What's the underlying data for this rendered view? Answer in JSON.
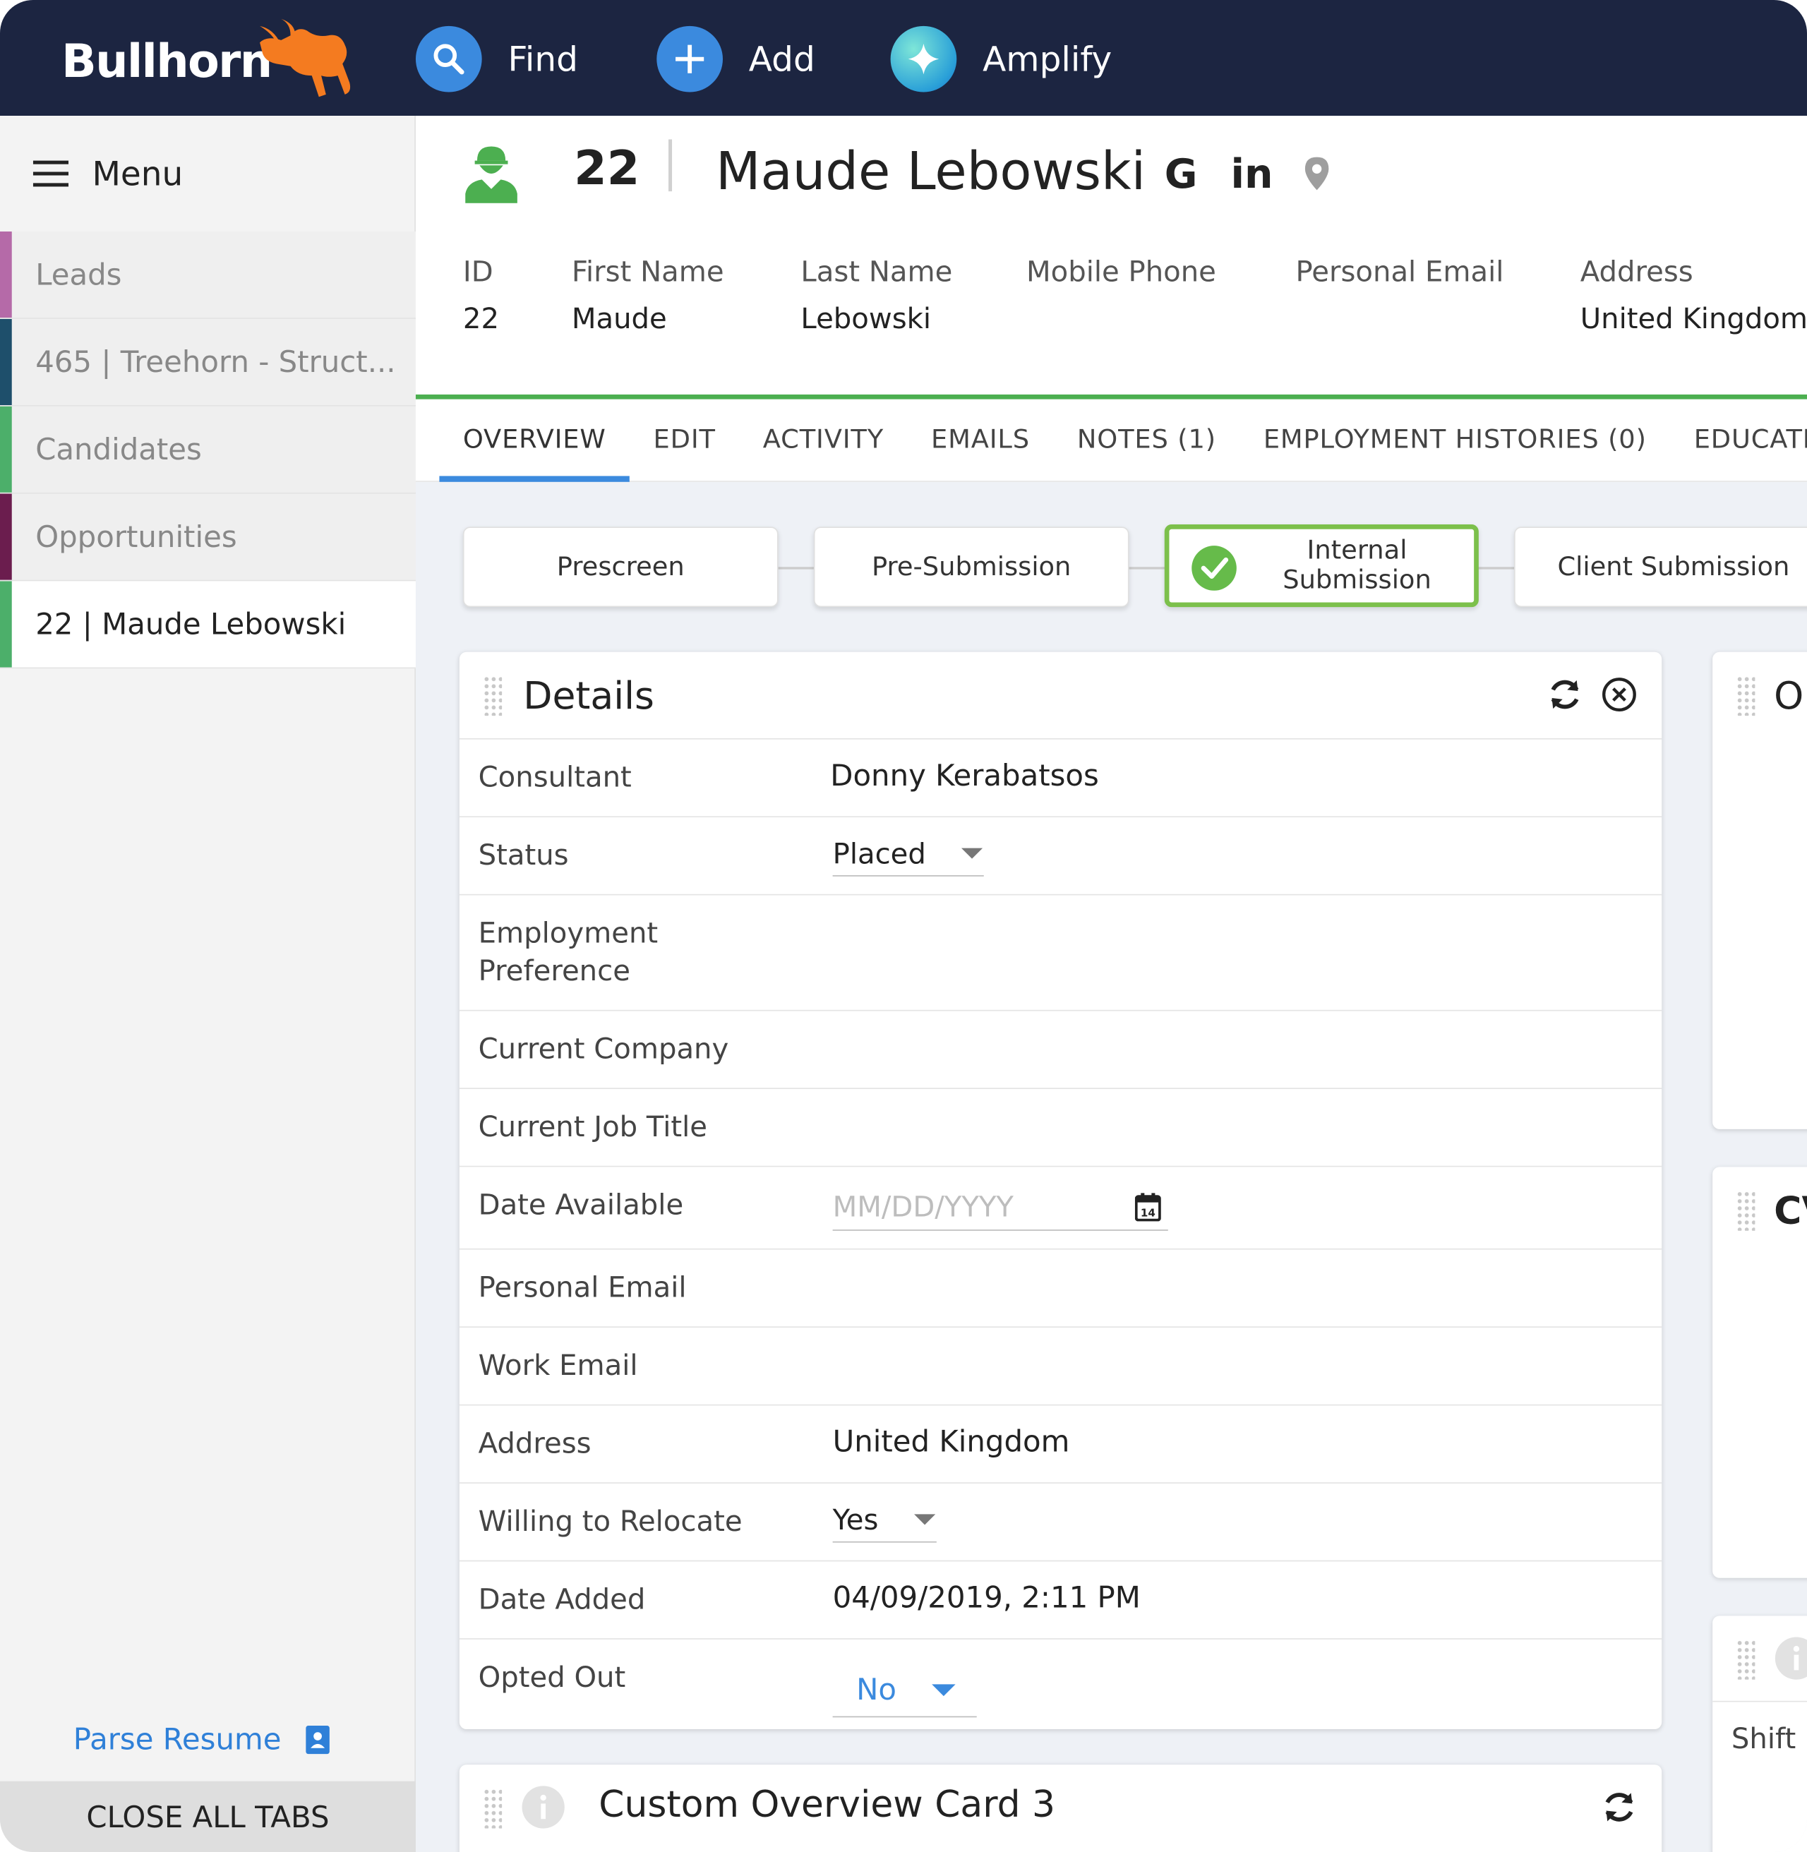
{
  "topbar": {
    "brand": "Bullhorn",
    "find_label": "Find",
    "add_label": "Add",
    "amplify_label": "Amplify"
  },
  "sidebar": {
    "menu_label": "Menu",
    "items": [
      {
        "label": "Leads",
        "color": "#b56aa8"
      },
      {
        "label": "465 | Treehorn - Struct...",
        "color": "#1e4f6b"
      },
      {
        "label": "Candidates",
        "color": "#4caf6a"
      },
      {
        "label": "Opportunities",
        "color": "#6b1d4e"
      },
      {
        "label": "22 | Maude Lebowski",
        "color": "#4caf6a",
        "active": true
      }
    ],
    "parse_resume": "Parse Resume",
    "close_all": "CLOSE ALL TABS"
  },
  "record": {
    "id": "22",
    "name": "Maude Lebowski",
    "google_label": "G",
    "linkedin_label": "in",
    "fields": [
      {
        "key": "ID",
        "value": "22"
      },
      {
        "key": "First Name",
        "value": "Maude"
      },
      {
        "key": "Last Name",
        "value": "Lebowski"
      },
      {
        "key": "Mobile Phone",
        "value": ""
      },
      {
        "key": "Personal Email",
        "value": ""
      },
      {
        "key": "Address",
        "value": "United Kingdom"
      }
    ]
  },
  "tabs": [
    "OVERVIEW",
    "EDIT",
    "ACTIVITY",
    "EMAILS",
    "NOTES (1)",
    "EMPLOYMENT HISTORIES (0)",
    "EDUCATION"
  ],
  "pipeline": {
    "stages": [
      {
        "label": "Prescreen",
        "done": false
      },
      {
        "label": "Pre-Submission",
        "done": false
      },
      {
        "label_line1": "Internal",
        "label_line2": "Submission",
        "done": true
      },
      {
        "label": "Client Submission",
        "done": false
      }
    ]
  },
  "details": {
    "title": "Details",
    "rows": {
      "consultant": {
        "label": "Consultant",
        "value": "Donny Kerabatsos"
      },
      "status": {
        "label": "Status",
        "value": "Placed"
      },
      "employment_pref": {
        "label_line1": "Employment",
        "label_line2": "Preference",
        "value": ""
      },
      "current_company": {
        "label": "Current Company",
        "value": ""
      },
      "current_job_title": {
        "label": "Current Job Title",
        "value": ""
      },
      "date_available": {
        "label": "Date Available",
        "placeholder": "MM/DD/YYYY",
        "calendar_day": "14"
      },
      "personal_email": {
        "label": "Personal Email",
        "value": ""
      },
      "work_email": {
        "label": "Work Email",
        "value": ""
      },
      "address": {
        "label": "Address",
        "value": "United Kingdom"
      },
      "willing_to_relocate": {
        "label": "Willing to Relocate",
        "value": "Yes"
      },
      "date_added": {
        "label": "Date Added",
        "value": "04/09/2019, 2:11 PM"
      },
      "opted_out": {
        "label": "Opted Out",
        "value": "No"
      }
    }
  },
  "custom_card": {
    "title": "Custom Overview Card 3"
  },
  "side_cards": {
    "card1_title": "O",
    "card2_title": "CV",
    "card3_text": "Shift I"
  },
  "colors": {
    "topbar": "#1c2541",
    "accent_blue": "#3b8ade",
    "green": "#4caf50",
    "stage_done": "#7cc04b",
    "bull_orange": "#f47b20"
  }
}
